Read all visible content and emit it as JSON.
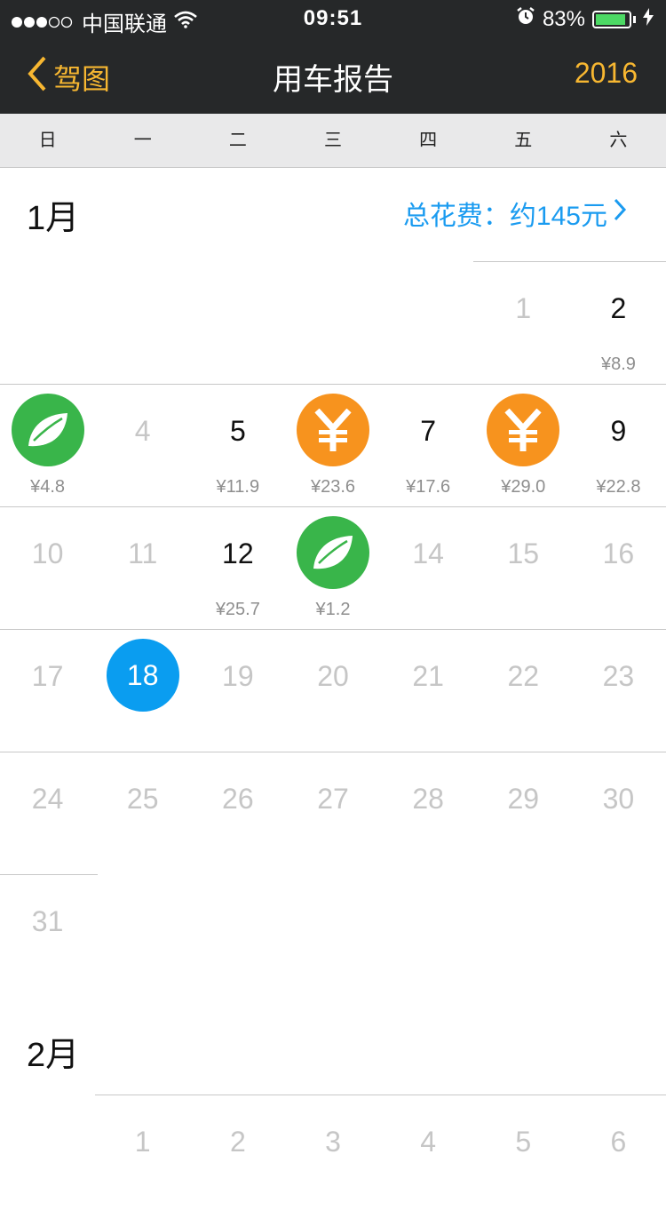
{
  "status_bar": {
    "carrier": "中国联通",
    "time": "09:51",
    "battery_percent": "83%",
    "battery_level": 0.83
  },
  "nav": {
    "back_label": "驾图",
    "title": "用车报告",
    "year": "2016"
  },
  "weekdays": [
    "日",
    "一",
    "二",
    "三",
    "四",
    "五",
    "六"
  ],
  "months": {
    "jan": {
      "title": "1月",
      "total_label": "总花费：约145元",
      "days": {
        "d1": {
          "num": "1"
        },
        "d2": {
          "num": "2",
          "cost": "¥8.9"
        },
        "d3": {
          "icon": "leaf-icon",
          "cost": "¥4.8"
        },
        "d4": {
          "num": "4"
        },
        "d5": {
          "num": "5",
          "cost": "¥11.9"
        },
        "d6": {
          "icon": "yuan-icon",
          "cost": "¥23.6"
        },
        "d7": {
          "num": "7",
          "cost": "¥17.6"
        },
        "d8": {
          "icon": "yuan-icon",
          "cost": "¥29.0"
        },
        "d9": {
          "num": "9",
          "cost": "¥22.8"
        },
        "d10": {
          "num": "10"
        },
        "d11": {
          "num": "11"
        },
        "d12": {
          "num": "12",
          "cost": "¥25.7"
        },
        "d13": {
          "icon": "leaf-icon",
          "cost": "¥1.2"
        },
        "d14": {
          "num": "14"
        },
        "d15": {
          "num": "15"
        },
        "d16": {
          "num": "16"
        },
        "d17": {
          "num": "17"
        },
        "d18": {
          "num": "18",
          "today": true
        },
        "d19": {
          "num": "19"
        },
        "d20": {
          "num": "20"
        },
        "d21": {
          "num": "21"
        },
        "d22": {
          "num": "22"
        },
        "d23": {
          "num": "23"
        },
        "d24": {
          "num": "24"
        },
        "d25": {
          "num": "25"
        },
        "d26": {
          "num": "26"
        },
        "d27": {
          "num": "27"
        },
        "d28": {
          "num": "28"
        },
        "d29": {
          "num": "29"
        },
        "d30": {
          "num": "30"
        },
        "d31": {
          "num": "31"
        }
      }
    },
    "feb": {
      "title": "2月",
      "days": {
        "d1": {
          "num": "1"
        },
        "d2": {
          "num": "2"
        },
        "d3": {
          "num": "3"
        },
        "d4": {
          "num": "4"
        },
        "d5": {
          "num": "5"
        },
        "d6": {
          "num": "6"
        }
      }
    }
  },
  "colors": {
    "accent_yellow": "#f7b731",
    "link_blue": "#1a9bf0",
    "leaf_green": "#39b54a",
    "yuan_orange": "#f7931e",
    "today_blue": "#0a9df0"
  }
}
